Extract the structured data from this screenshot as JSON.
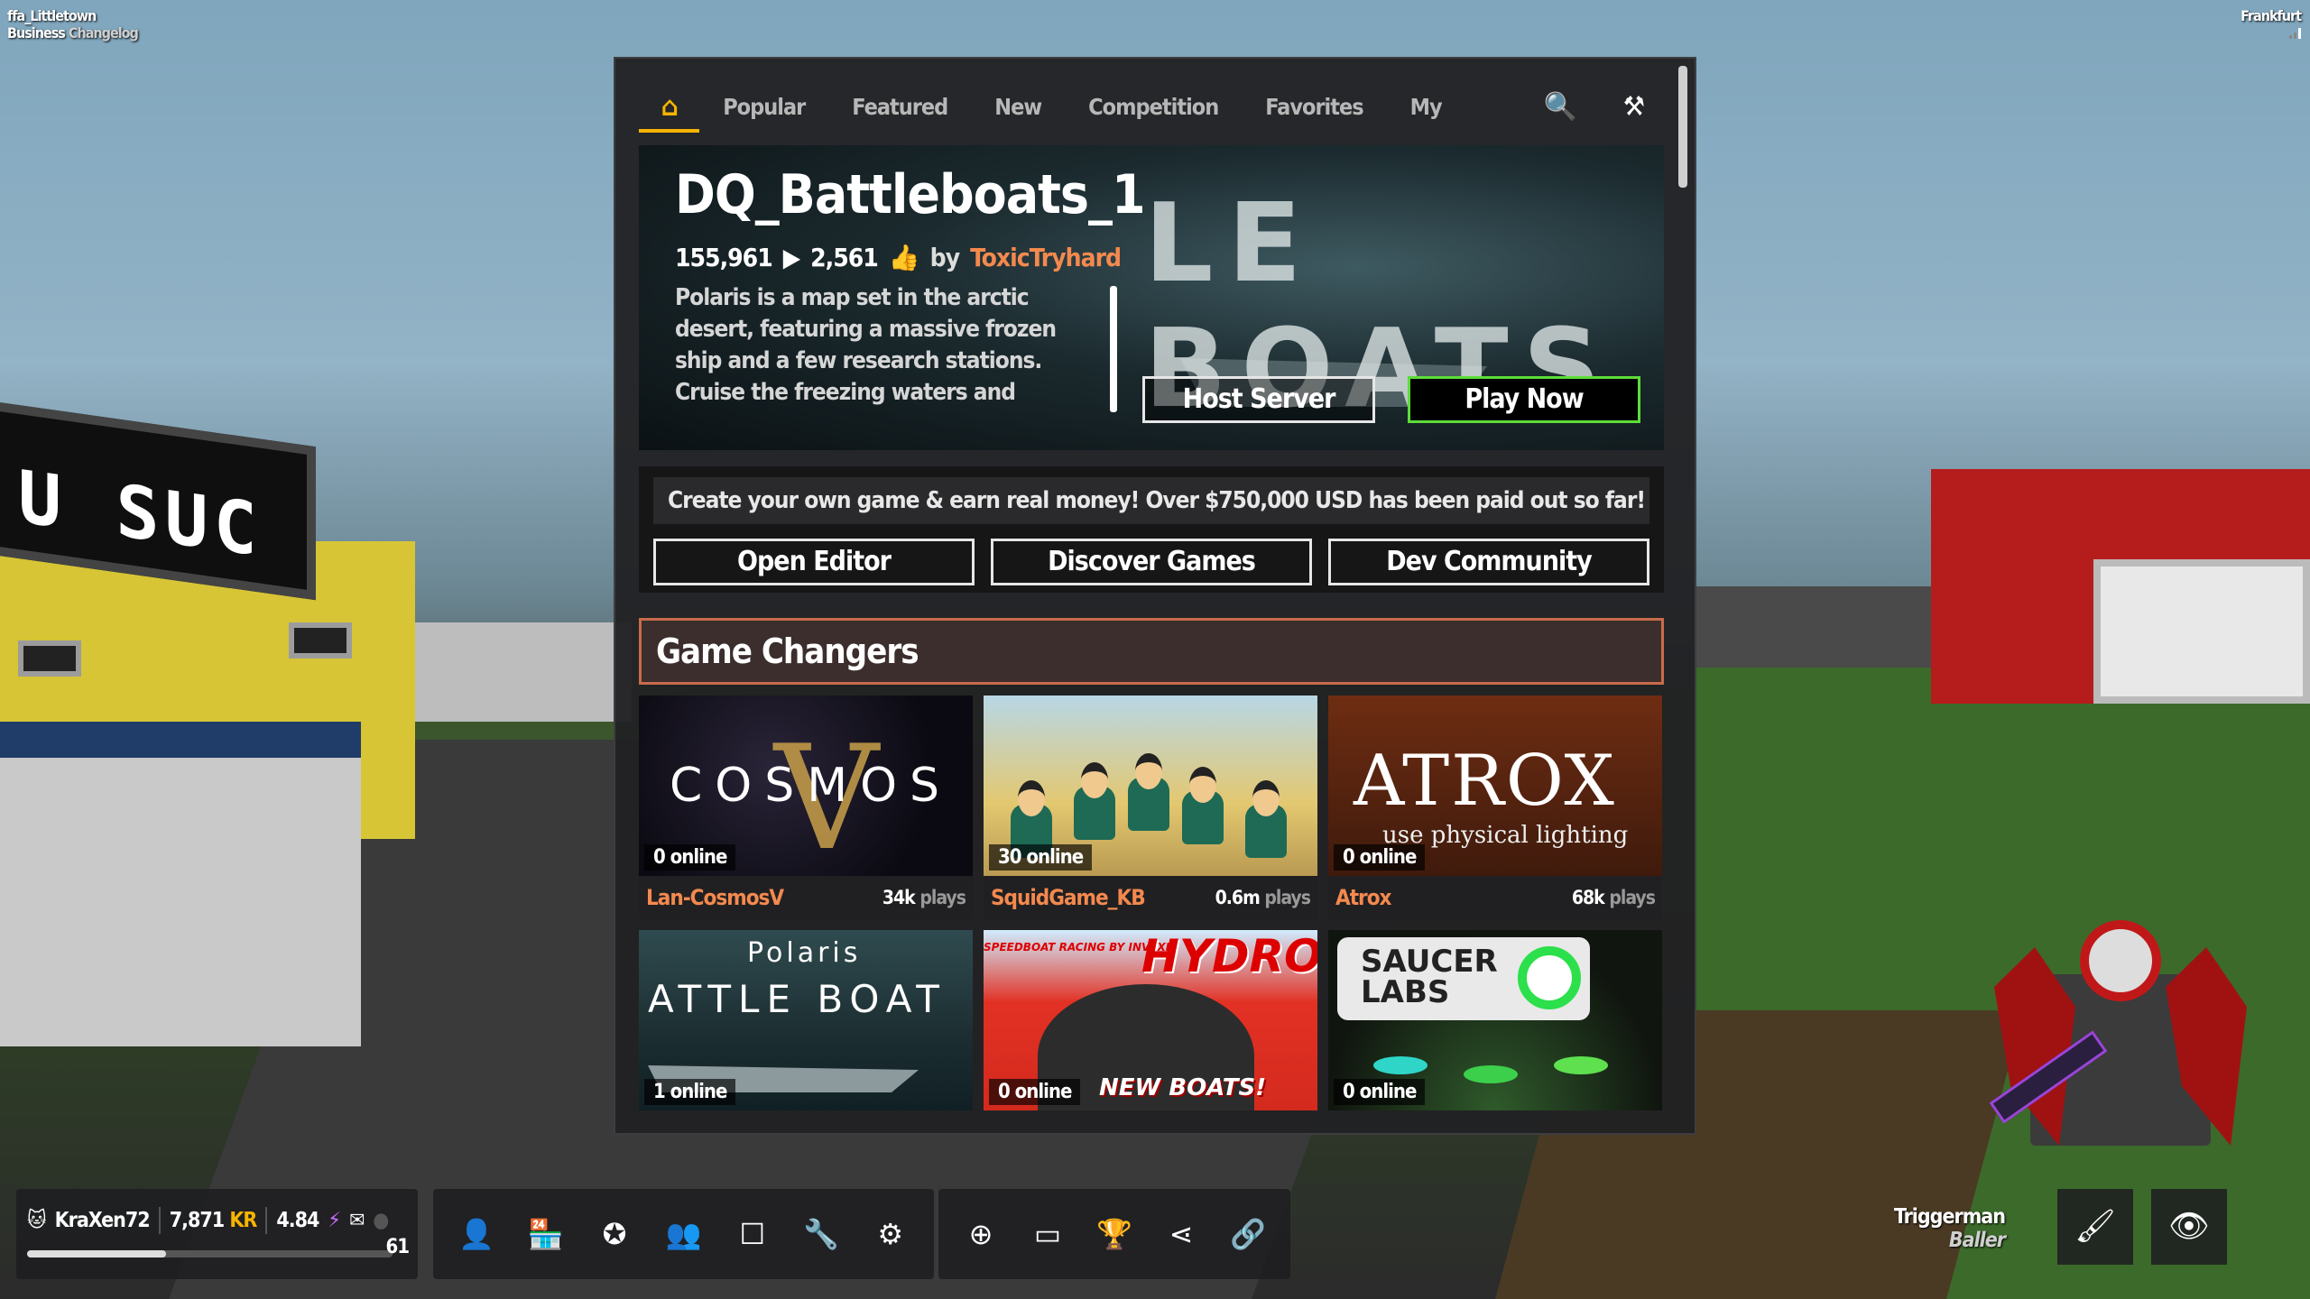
{
  "hud_top_left": {
    "map": "ffa_Littletown",
    "item1": "Business",
    "item2": "Changelog"
  },
  "hud_top_right": {
    "region": "Frankfurt"
  },
  "tabs": [
    {
      "label": "⌂",
      "icon": "home-icon"
    },
    {
      "label": "Popular"
    },
    {
      "label": "Featured"
    },
    {
      "label": "New"
    },
    {
      "label": "Competition"
    },
    {
      "label": "Favorites"
    },
    {
      "label": "My Games"
    }
  ],
  "tab_icons": {
    "search": "🔍",
    "tools": "⚒"
  },
  "featured": {
    "title": "DQ_Battleboats_1",
    "bg_text": "LE BOATS",
    "plays": "155,961",
    "likes": "2,561",
    "by": "by",
    "author": "ToxicTryhard",
    "description": "Polaris is a map set in the arctic desert, featuring a massive frozen ship and a few research stations. Cruise the freezing waters and",
    "host_label": "Host Server",
    "play_label": "Play Now"
  },
  "promo": {
    "message": "Create your own game & earn real money! Over $750,000 USD has been paid out so far!",
    "buttons": [
      "Open Editor",
      "Discover Games",
      "Dev Community"
    ]
  },
  "section": {
    "title": "Game Changers"
  },
  "games": [
    {
      "name": "Lan-CosmosV",
      "online": "0 online",
      "plays_value": "34k",
      "plays_unit": "plays",
      "art_text": "COSMOS",
      "art_letter": "V"
    },
    {
      "name": "SquidGame_KB",
      "online": "30 online",
      "plays_value": "0.6m",
      "plays_unit": "plays"
    },
    {
      "name": "Atrox",
      "online": "0 online",
      "plays_value": "68k",
      "plays_unit": "plays",
      "art_text": "ATROX",
      "art_sub": "use physical lighting"
    },
    {
      "name": "",
      "online": "1 online",
      "plays_value": "",
      "plays_unit": "",
      "art_text1": "Polaris",
      "art_text2": "ATTLE BOAT"
    },
    {
      "name": "",
      "online": "0 online",
      "plays_value": "",
      "plays_unit": "",
      "art_text": "HYDRO",
      "art_tag": "SPEEDBOAT RACING BY INVEXI",
      "art_new": "NEW BOATS!"
    },
    {
      "name": "",
      "online": "0 online",
      "plays_value": "",
      "plays_unit": "",
      "art_text": "SAUCER LABS"
    }
  ],
  "user": {
    "name": "KraXen72",
    "kr_value": "7,871",
    "kr_unit": "KR",
    "gems": "4.84",
    "level": "61",
    "level_progress": 0.38
  },
  "nav_icons": [
    "person-icon",
    "store-icon",
    "star-icon",
    "friends-icon",
    "square-icon",
    "wrench-icon",
    "gear-icon"
  ],
  "action_icons": [
    "plus-icon",
    "window-icon",
    "trophy-icon",
    "share-icon",
    "link-icon"
  ],
  "player": {
    "name": "Triggerman",
    "class": "Baller"
  },
  "colors": {
    "accent": "#f6b400",
    "author": "#f4894e",
    "play_border": "#5ddc3a",
    "section_border": "#c96b4b"
  }
}
